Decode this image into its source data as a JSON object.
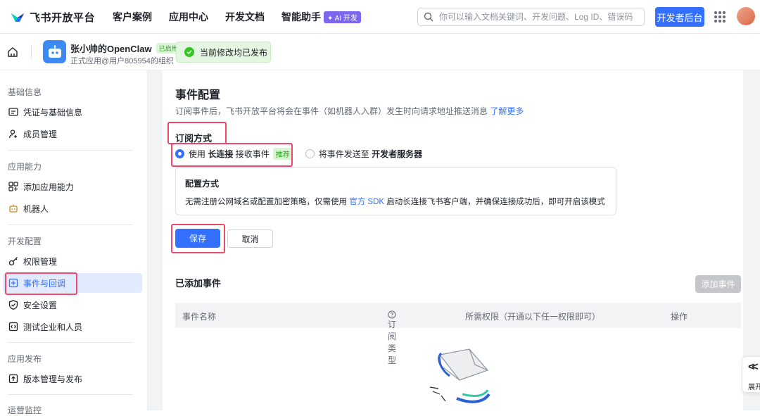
{
  "header": {
    "brand": "飞书开放平台",
    "nav": [
      "客户案例",
      "应用中心",
      "开发文档",
      "智能助手"
    ],
    "ai_badge": "✦ AI 开发",
    "search_placeholder": "你可以输入文档关键词、开发问题、Log ID、错误码",
    "dev_console": "开发者后台"
  },
  "app": {
    "name": "张小帅的OpenClaw",
    "status": "已启用",
    "org": "正式应用@用户805954的组织",
    "publish_notice": "当前修改均已发布"
  },
  "sidebar": {
    "sections": [
      {
        "title": "基础信息",
        "items": [
          "凭证与基础信息",
          "成员管理"
        ]
      },
      {
        "title": "应用能力",
        "items": [
          "添加应用能力",
          "机器人"
        ]
      },
      {
        "title": "开发配置",
        "items": [
          "权限管理",
          "事件与回调",
          "安全设置",
          "测试企业和人员"
        ]
      },
      {
        "title": "应用发布",
        "items": [
          "版本管理与发布"
        ]
      },
      {
        "title": "运营监控",
        "items": []
      }
    ],
    "active": "事件与回调"
  },
  "main": {
    "title": "事件配置",
    "desc": "订阅事件后，飞书开放平台将会在事件（如机器人入群）发生时向请求地址推送消息",
    "learn_more": "了解更多",
    "sub_mode_title": "订阅方式",
    "option1": {
      "prefix": "使用",
      "bold": "长连接",
      "suffix": "接收事件",
      "badge": "推荐"
    },
    "option2": {
      "prefix": "将事件发送至",
      "bold": "开发者服务器"
    },
    "config": {
      "title": "配置方式",
      "text_before": "无需注册公网域名或配置加密策略，仅需使用",
      "link": "官方 SDK",
      "text_after": "启动长连接飞书客户端，并确保连接成功后，即可开启该模式"
    },
    "save": "保存",
    "cancel": "取消",
    "added_title": "已添加事件",
    "add_event": "添加事件",
    "table_headers": [
      "事件名称",
      "订阅类型",
      "所需权限（开通以下任一权限即可）",
      "操作"
    ]
  },
  "expand_label": "展开"
}
